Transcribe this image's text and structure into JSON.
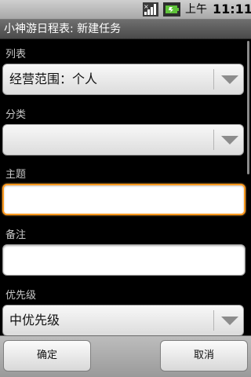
{
  "status_bar": {
    "ampm": "上午",
    "time": "11:11",
    "icons": [
      "signal-icon",
      "battery-charging-icon"
    ]
  },
  "title_bar": {
    "title": "小神游日程表: 新建任务"
  },
  "form": {
    "list": {
      "label": "列表",
      "value": "经营范围：个人"
    },
    "category": {
      "label": "分类",
      "value": ""
    },
    "subject": {
      "label": "主题",
      "value": ""
    },
    "note": {
      "label": "备注",
      "value": ""
    },
    "priority": {
      "label": "优先级",
      "value": "中优先级"
    }
  },
  "buttons": {
    "ok_label": "确定",
    "cancel_label": "取消"
  },
  "colors": {
    "focus_border": "#ff9a1f",
    "background": "#000000"
  }
}
